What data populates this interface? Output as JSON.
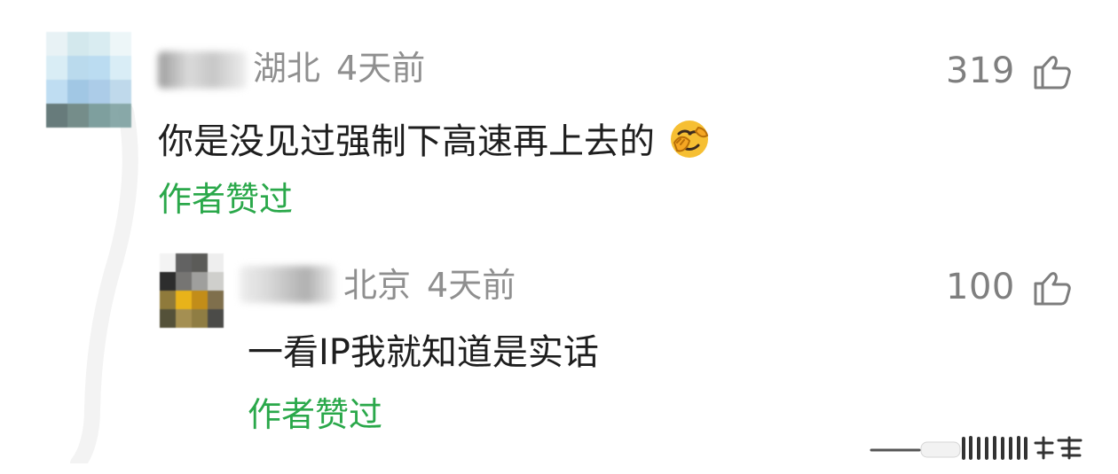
{
  "comment": {
    "location": "湖北",
    "time": "4天前",
    "text": "你是没见过强制下高速再上去的",
    "author_liked": "作者赞过",
    "like_count": "319"
  },
  "reply": {
    "location": "北京",
    "time": "4天前",
    "text": "一看IP我就知道是实话",
    "author_liked": "作者赞过",
    "like_count": "100"
  },
  "icons": {
    "main_avatar": "avatar-icon",
    "reply_avatar": "avatar-icon",
    "emoji": "facepalm-emoji-icon",
    "like": "thumbs-up-icon",
    "watermark": "watermark-icon"
  },
  "colors": {
    "text_primary": "#1e1e1e",
    "text_secondary": "#8f8f8f",
    "accent_green": "#2aa84a",
    "background": "#ffffff"
  }
}
